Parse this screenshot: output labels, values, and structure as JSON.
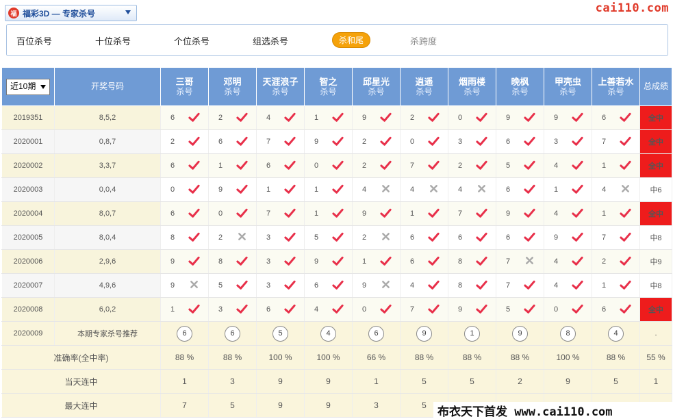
{
  "header": {
    "logo_glyph": "福",
    "lottery_select": "福彩3D — 专家杀号",
    "site": "cai110.com"
  },
  "tabs": [
    {
      "label": "百位杀号",
      "state": "normal"
    },
    {
      "label": "十位杀号",
      "state": "normal"
    },
    {
      "label": "个位杀号",
      "state": "normal"
    },
    {
      "label": "组选杀号",
      "state": "normal"
    },
    {
      "label": "杀和尾",
      "state": "active"
    },
    {
      "label": "杀跨度",
      "state": "muted"
    }
  ],
  "table": {
    "period_select": "近10期",
    "draw_header": "开奖号码",
    "sub_label": "杀号",
    "total_header": "总成绩",
    "experts": [
      "三哥",
      "邓明",
      "天涯浪子",
      "智之",
      "邱星光",
      "逍遥",
      "烟雨楼",
      "晚枫",
      "甲壳虫",
      "上善若水"
    ],
    "rows": [
      {
        "period": "2019351",
        "draw": "8,5,2",
        "kills": [
          6,
          2,
          4,
          1,
          9,
          2,
          0,
          9,
          9,
          6
        ],
        "hits": [
          1,
          1,
          1,
          1,
          1,
          1,
          1,
          1,
          1,
          1
        ],
        "total": "全中"
      },
      {
        "period": "2020001",
        "draw": "0,8,7",
        "kills": [
          2,
          6,
          7,
          9,
          2,
          0,
          3,
          6,
          3,
          7
        ],
        "hits": [
          1,
          1,
          1,
          1,
          1,
          1,
          1,
          1,
          1,
          1
        ],
        "total": "全中"
      },
      {
        "period": "2020002",
        "draw": "3,3,7",
        "kills": [
          6,
          1,
          6,
          0,
          2,
          7,
          2,
          5,
          4,
          1
        ],
        "hits": [
          1,
          1,
          1,
          1,
          1,
          1,
          1,
          1,
          1,
          1
        ],
        "total": "全中"
      },
      {
        "period": "2020003",
        "draw": "0,0,4",
        "kills": [
          0,
          9,
          1,
          1,
          4,
          4,
          4,
          6,
          1,
          4
        ],
        "hits": [
          1,
          1,
          1,
          1,
          0,
          0,
          0,
          1,
          1,
          0
        ],
        "total": "中6"
      },
      {
        "period": "2020004",
        "draw": "8,0,7",
        "kills": [
          6,
          0,
          7,
          1,
          9,
          1,
          7,
          9,
          4,
          1
        ],
        "hits": [
          1,
          1,
          1,
          1,
          1,
          1,
          1,
          1,
          1,
          1
        ],
        "total": "全中"
      },
      {
        "period": "2020005",
        "draw": "8,0,4",
        "kills": [
          8,
          2,
          3,
          5,
          2,
          6,
          6,
          6,
          9,
          7
        ],
        "hits": [
          1,
          0,
          1,
          1,
          0,
          1,
          1,
          1,
          1,
          1
        ],
        "total": "中8"
      },
      {
        "period": "2020006",
        "draw": "2,9,6",
        "kills": [
          9,
          8,
          3,
          9,
          1,
          6,
          8,
          7,
          4,
          2
        ],
        "hits": [
          1,
          1,
          1,
          1,
          1,
          1,
          1,
          0,
          1,
          1
        ],
        "total": "中9"
      },
      {
        "period": "2020007",
        "draw": "4,9,6",
        "kills": [
          9,
          5,
          3,
          6,
          9,
          4,
          8,
          7,
          4,
          1
        ],
        "hits": [
          0,
          1,
          1,
          1,
          0,
          1,
          1,
          1,
          1,
          1
        ],
        "total": "中8"
      },
      {
        "period": "2020008",
        "draw": "6,0,2",
        "kills": [
          1,
          3,
          6,
          4,
          0,
          7,
          9,
          5,
          0,
          6
        ],
        "hits": [
          1,
          1,
          1,
          1,
          1,
          1,
          1,
          1,
          1,
          1
        ],
        "total": "全中"
      }
    ],
    "recommend": {
      "period": "2020009",
      "label": "本期专家杀号推荐",
      "values": [
        6,
        6,
        5,
        4,
        6,
        9,
        1,
        9,
        8,
        4
      ],
      "total": "."
    },
    "stats": [
      {
        "label": "准确率(全中率)",
        "values": [
          "88 %",
          "88 %",
          "100 %",
          "100 %",
          "66 %",
          "88 %",
          "88 %",
          "88 %",
          "100 %",
          "88 %"
        ],
        "total": "55 %"
      },
      {
        "label": "当天连中",
        "values": [
          "1",
          "3",
          "9",
          "9",
          "1",
          "5",
          "5",
          "2",
          "9",
          "5"
        ],
        "total": "1"
      },
      {
        "label": "最大连中",
        "values": [
          "7",
          "5",
          "9",
          "9",
          "3",
          "5",
          "",
          "",
          "",
          ""
        ],
        "total": ""
      }
    ]
  },
  "watermark": "布衣天下首发 www.cai110.com",
  "colors": {
    "header_blue": "#6f9bd5",
    "hit_red": "#ee1c1c",
    "check_red": "#e8304a",
    "miss_gray": "#aaaaaa",
    "active_tab": "#f5a20a"
  }
}
